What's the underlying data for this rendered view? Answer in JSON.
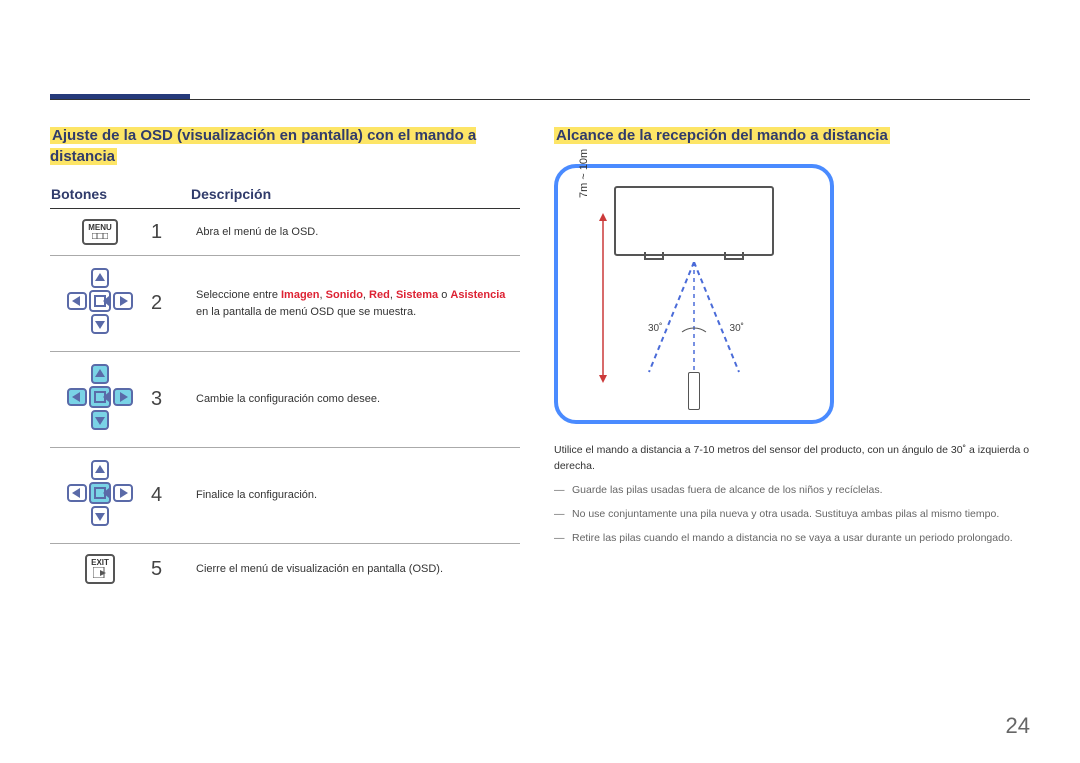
{
  "left": {
    "heading": "Ajuste de la OSD (visualización en pantalla) con el mando a distancia",
    "col_buttons": "Botones",
    "col_desc": "Descripción",
    "rows": [
      {
        "icon": "menu",
        "n": "1",
        "desc": "Abra el menú de la OSD."
      },
      {
        "icon": "dpad",
        "n": "2",
        "desc": "Seleccione entre ",
        "terms": [
          "Imagen",
          "Sonido",
          "Red",
          "Sistema"
        ],
        "sep": ", ",
        "or": " o ",
        "desc2": " en la pantalla de menú OSD que se muestra.",
        "lastTerm": "Asistencia"
      },
      {
        "icon": "dpad-on",
        "n": "3",
        "desc": "Cambie la configuración como desee."
      },
      {
        "icon": "dpad",
        "n": "4",
        "desc": "Finalice la configuración."
      },
      {
        "icon": "exit",
        "n": "5",
        "desc": "Cierre el menú de visualización en pantalla (OSD)."
      }
    ],
    "menu_label": "MENU",
    "exit_label": "EXIT"
  },
  "right": {
    "heading": "Alcance de la recepción del mando a distancia",
    "range": "7m ~ 10m",
    "ang": "30˚",
    "note": "Utilice el mando a distancia a 7-10 metros del sensor del producto, con un ángulo de 30˚ a izquierda o derecha.",
    "bullets": [
      "Guarde las pilas usadas fuera de alcance de los niños y recíclelas.",
      "No use conjuntamente una pila nueva y otra usada. Sustituya ambas pilas al mismo tiempo.",
      "Retire las pilas cuando el mando a distancia no se vaya a usar durante un periodo prolongado."
    ]
  },
  "page_number": "24"
}
